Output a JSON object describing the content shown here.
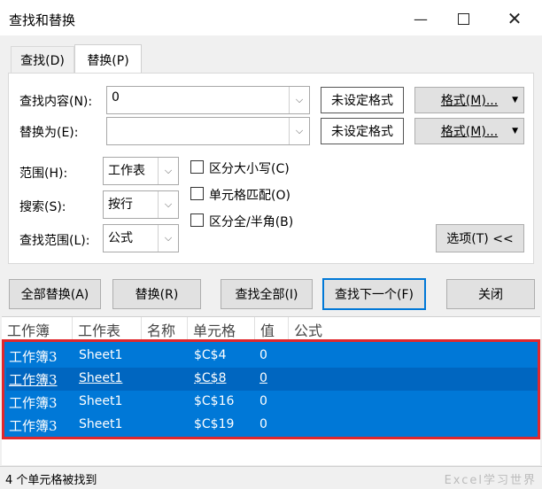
{
  "window": {
    "title": "查找和替换"
  },
  "tabs": [
    {
      "label": "查找(D)"
    },
    {
      "label": "替换(P)"
    }
  ],
  "find": {
    "label": "查找内容(N):",
    "value": "0",
    "format_preview": "未设定格式",
    "format_button": "格式(M)..."
  },
  "replace": {
    "label": "替换为(E):",
    "value": "",
    "format_preview": "未设定格式",
    "format_button": "格式(M)..."
  },
  "options": {
    "scope": {
      "label": "范围(H):",
      "value": "工作表"
    },
    "search": {
      "label": "搜索(S):",
      "value": "按行"
    },
    "look_in": {
      "label": "查找范围(L):",
      "value": "公式"
    },
    "match_case": {
      "label": "区分大小写(C)",
      "checked": false
    },
    "match_entire": {
      "label": "单元格匹配(O)",
      "checked": false
    },
    "match_byte": {
      "label": "区分全/半角(B)",
      "checked": false
    },
    "options_button": "选项(T) <<"
  },
  "actions": {
    "replace_all": "全部替换(A)",
    "replace": "替换(R)",
    "find_all": "查找全部(I)",
    "find_next": "查找下一个(F)",
    "close": "关闭"
  },
  "results": {
    "columns": [
      "工作簿",
      "工作表",
      "名称",
      "单元格",
      "值",
      "公式"
    ],
    "rows": [
      {
        "book": "工作簿3",
        "sheet": "Sheet1",
        "name": "",
        "cell": "$C$4",
        "value": "0",
        "formula": ""
      },
      {
        "book": "工作簿3",
        "sheet": "Sheet1",
        "name": "",
        "cell": "$C$8",
        "value": "0",
        "formula": ""
      },
      {
        "book": "工作簿3",
        "sheet": "Sheet1",
        "name": "",
        "cell": "$C$16",
        "value": "0",
        "formula": ""
      },
      {
        "book": "工作簿3",
        "sheet": "Sheet1",
        "name": "",
        "cell": "$C$19",
        "value": "0",
        "formula": ""
      }
    ],
    "selected_row": 1,
    "selection_color": "#0078d7",
    "highlight_border_color": "#e0282d"
  },
  "status": {
    "text": "4 个单元格被找到"
  },
  "watermark": "Excel学习世界"
}
